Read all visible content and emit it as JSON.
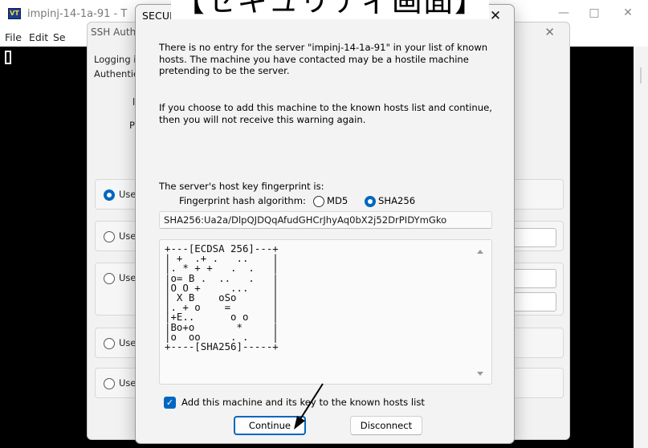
{
  "terminal": {
    "title": "impinj-14-1a-91 - T",
    "icon_label": "VT",
    "menu": [
      "File",
      "Edit",
      "Se"
    ],
    "controls": {
      "minimize": "—",
      "maximize": "□",
      "close": "✕"
    }
  },
  "ssh_dialog": {
    "title": "SSH Auth",
    "close": "✕",
    "logging_label": "Logging i",
    "auth_label": "Authentic",
    "field_label_1": "l",
    "field_label_2": "P",
    "options": [
      "Use",
      "Use",
      "Use",
      "Use",
      "Use"
    ],
    "selected_option_index": 0
  },
  "caption": "【セキュリティ画面】",
  "security_dialog": {
    "title": "SECURITY WARNING",
    "close": "✕",
    "paragraph_1": "There is no entry for the server \"impinj-14-1a-91\" in your list of known hosts. The machine you have contacted may be a hostile machine pretending to be the server.",
    "paragraph_2": "If you choose to add this machine to the known hosts list and continue, then you will not receive this warning again.",
    "fingerprint_heading": "The server's host key fingerprint is:",
    "hash_algorithm_label": "Fingerprint hash algorithm:",
    "hash_options": [
      "MD5",
      "SHA256"
    ],
    "hash_selected": "SHA256",
    "fingerprint_value": "SHA256:Ua2a/DlpQJDQqAfudGHCrJhyAq0bX2j52DrPIDYmGko",
    "randomart": [
      "+---[ECDSA 256]---+",
      "| +  .+ .   ..    |",
      "|. * + +   .  .   |",
      "|o= B .  ..   .   |",
      "|O O +     ...    |",
      "| X B    oSo      |",
      "|. + o    =       |",
      "|+E..      o o    |",
      "|Bo+o       *     |",
      "|o  oo     . .    |",
      "+----[SHA256]-----+"
    ],
    "add_host_checkbox_label": "Add this machine and its key to the known hosts list",
    "add_host_checked": true,
    "continue_label": "Continue",
    "disconnect_label": "Disconnect"
  },
  "colors": {
    "accent": "#0067c0",
    "terminal_bg": "#000000"
  }
}
